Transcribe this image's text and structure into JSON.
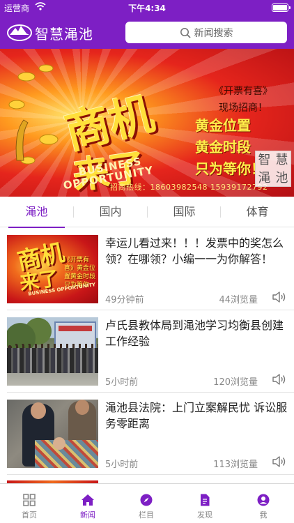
{
  "status_bar": {
    "carrier": "运营商",
    "time": "下午4:34"
  },
  "app": {
    "title": "智慧渑池",
    "accent_color": "#7d1fc4",
    "logo_icon": "mountain-logo-icon"
  },
  "search": {
    "placeholder": "新闻搜索",
    "icon": "search-icon"
  },
  "banner": {
    "headline_1": "商机",
    "headline_2": "来了",
    "english_1": "BUSINESS",
    "english_2": "OPPORTUNITY",
    "tag": "《开票有喜》",
    "subtag": "现场招商！",
    "lines": [
      "黄金位置",
      "黄金时段",
      "只为等你！"
    ],
    "hotline": "招商热线：18603982548   15939172792",
    "watermark": [
      "智",
      "慧",
      "渑",
      "池"
    ]
  },
  "tabs": [
    {
      "label": "渑池",
      "active": true
    },
    {
      "label": "国内",
      "active": false
    },
    {
      "label": "国际",
      "active": false
    },
    {
      "label": "体育",
      "active": false
    }
  ],
  "news": [
    {
      "title": "幸运儿看过来！！！发票中的奖怎么领？在哪领？小编一一为你解答！",
      "time": "49分钟前",
      "views": "44浏览量"
    },
    {
      "title": "卢氏县教体局到渑池学习均衡县创建工作经验",
      "time": "5小时前",
      "views": "120浏览量"
    },
    {
      "title": "渑池县法院：上门立案解民忧 诉讼服务零距离",
      "time": "5小时前",
      "views": "113浏览量"
    }
  ],
  "thumb_1": {
    "t1": "商机",
    "t2": "来了",
    "t3": "《开票有喜》黄金位置黄金时段只为等你",
    "t4": "BUSINESS OPPORTUNITY"
  },
  "tabbar": [
    {
      "label": "首页",
      "icon": "grid-icon",
      "active": false
    },
    {
      "label": "新闻",
      "icon": "home-icon",
      "active": true
    },
    {
      "label": "栏目",
      "icon": "compass-icon",
      "active": false
    },
    {
      "label": "发现",
      "icon": "document-icon",
      "active": false
    },
    {
      "label": "我",
      "icon": "user-icon",
      "active": false
    }
  ]
}
